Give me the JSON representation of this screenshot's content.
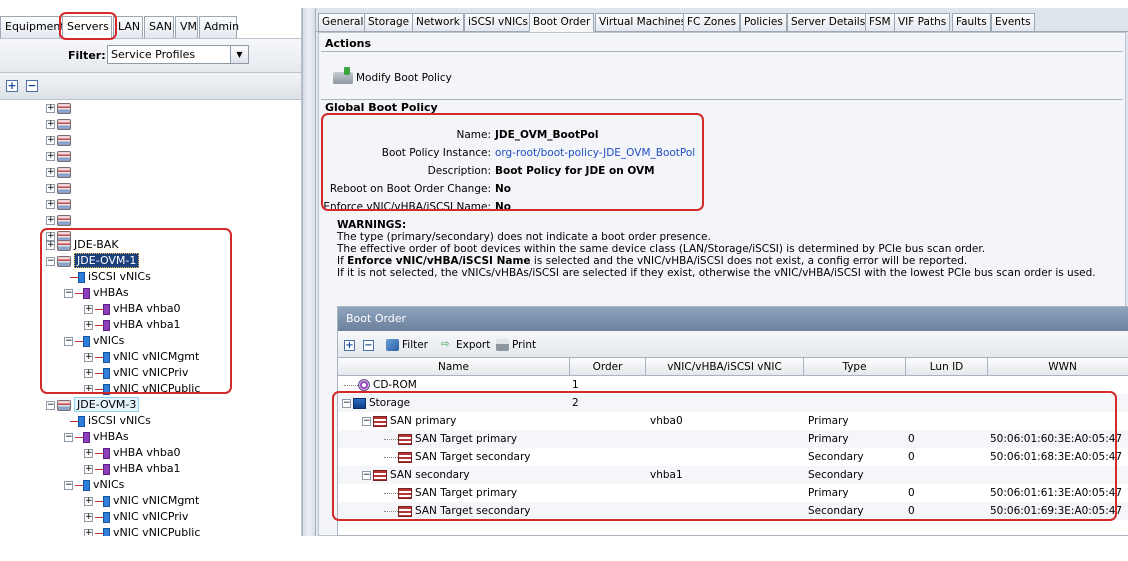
{
  "left": {
    "tabs": [
      "Equipment",
      "Servers",
      "LAN",
      "SAN",
      "VM",
      "Admin"
    ],
    "active_tab": "Servers",
    "filter_label": "Filter:",
    "filter_value": "Service Profiles",
    "tree": {
      "jde_bak": "JDE-BAK",
      "jde_ovm_1": {
        "label": "JDE-OVM-1",
        "iscsi": "iSCSI vNICs",
        "vhbas": "vHBAs",
        "vhba0": "vHBA vhba0",
        "vhba1": "vHBA vhba1",
        "vnics": "vNICs",
        "vnic_mgmt": "vNIC vNICMgmt",
        "vnic_priv": "vNIC vNICPriv",
        "vnic_public": "vNIC vNICPublic"
      },
      "jde_ovm_3": {
        "label": "JDE-OVM-3",
        "iscsi": "iSCSI vNICs",
        "vhbas": "vHBAs",
        "vhba0": "vHBA vhba0",
        "vhba1": "vHBA vhba1",
        "vnics": "vNICs",
        "vnic_mgmt": "vNIC vNICMgmt",
        "vnic_priv": "vNIC vNICPriv",
        "vnic_public": "vNIC vNICPublic"
      }
    }
  },
  "right": {
    "tabs": [
      "General",
      "Storage",
      "Network",
      "iSCSI vNICs",
      "Boot Order",
      "Virtual Machines",
      "FC Zones",
      "Policies",
      "Server Details",
      "FSM",
      "VIF Paths",
      "Faults",
      "Events"
    ],
    "active_tab": "Boot Order",
    "actions_title": "Actions",
    "modify_boot_policy": "Modify Boot Policy",
    "global_title": "Global Boot Policy",
    "policy": {
      "name_label": "Name:",
      "name_value": "JDE_OVM_BootPol",
      "instance_label": "Boot Policy Instance:",
      "instance_value": "org-root/boot-policy-JDE_OVM_BootPol",
      "description_label": "Description:",
      "description_value": "Boot Policy for JDE on OVM",
      "reboot_label": "Reboot on Boot Order Change:",
      "reboot_value": "No",
      "enforce_label": "Enforce vNIC/vHBA/iSCSI Name:",
      "enforce_value": "No"
    },
    "warnings": {
      "title": "WARNINGS:",
      "line1": "The type (primary/secondary) does not indicate a boot order presence.",
      "line2": "The effective order of boot devices within the same device class (LAN/Storage/iSCSI) is determined by PCIe bus scan order.",
      "line3_pre": "If ",
      "line3_bold": "Enforce vNIC/vHBA/iSCSI Name",
      "line3_post": " is selected and the vNIC/vHBA/iSCSI does not exist, a config error will be reported.",
      "line4": "If it is not selected, the vNICs/vHBAs/iSCSI are selected if they exist, otherwise the vNIC/vHBA/iSCSI with the lowest PCIe bus scan order is used."
    },
    "boot_order": {
      "title": "Boot Order",
      "tools": {
        "filter": "Filter",
        "export": "Export",
        "print": "Print"
      },
      "columns": [
        "Name",
        "Order",
        "vNIC/vHBA/iSCSI vNIC",
        "Type",
        "Lun ID",
        "WWN"
      ],
      "rows": [
        {
          "name": "CD-ROM",
          "order": "1",
          "vnic": "",
          "type": "",
          "lun": "",
          "wwn": ""
        },
        {
          "name": "Storage",
          "order": "2",
          "vnic": "",
          "type": "",
          "lun": "",
          "wwn": ""
        },
        {
          "name": "SAN primary",
          "order": "",
          "vnic": "vhba0",
          "type": "Primary",
          "lun": "",
          "wwn": ""
        },
        {
          "name": "SAN Target primary",
          "order": "",
          "vnic": "",
          "type": "Primary",
          "lun": "0",
          "wwn": "50:06:01:60:3E:A0:05:47"
        },
        {
          "name": "SAN Target secondary",
          "order": "",
          "vnic": "",
          "type": "Secondary",
          "lun": "0",
          "wwn": "50:06:01:68:3E:A0:05:47"
        },
        {
          "name": "SAN secondary",
          "order": "",
          "vnic": "vhba1",
          "type": "Secondary",
          "lun": "",
          "wwn": ""
        },
        {
          "name": "SAN Target primary",
          "order": "",
          "vnic": "",
          "type": "Primary",
          "lun": "0",
          "wwn": "50:06:01:61:3E:A0:05:47"
        },
        {
          "name": "SAN Target secondary",
          "order": "",
          "vnic": "",
          "type": "Secondary",
          "lun": "0",
          "wwn": "50:06:01:69:3E:A0:05:47"
        }
      ]
    }
  },
  "colors": {
    "highlight": "#d42a2a",
    "link": "#1f4fc4",
    "selection": "#1c3f7e"
  }
}
